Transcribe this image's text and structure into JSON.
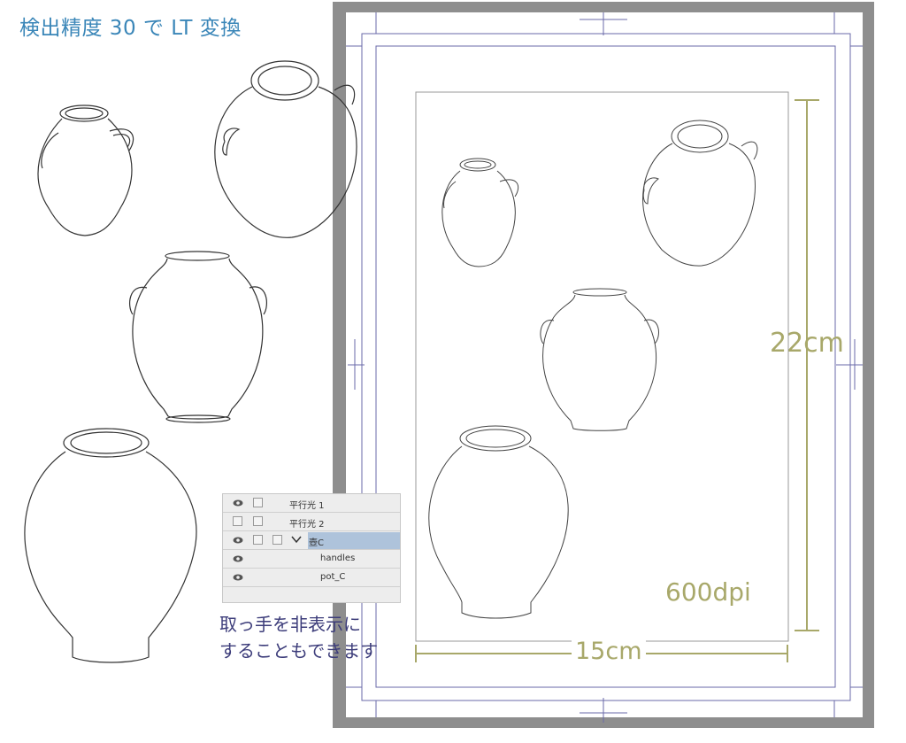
{
  "title": "検出精度 30 で LT 変換",
  "canvas": {
    "height_label": "22cm",
    "width_label": "15cm",
    "dpi_label": "600dpi"
  },
  "layers_panel": {
    "rows": [
      {
        "name": "平行光 1",
        "visible": true,
        "selected": false
      },
      {
        "name": "平行光 2",
        "visible": false,
        "selected": false
      },
      {
        "name": "壺C",
        "visible": true,
        "selected": true,
        "folder": true
      },
      {
        "name": "handles",
        "visible": true,
        "selected": false
      },
      {
        "name": "pot_C",
        "visible": true,
        "selected": false
      }
    ]
  },
  "caption": {
    "line1": "取っ手を非表示に",
    "line2": "することもできます"
  },
  "colors": {
    "title": "#3a86b8",
    "measure": "#a8a86a",
    "guide": "#6a6aa8",
    "selection": "#aec3db",
    "caption": "#3c3c7a"
  }
}
